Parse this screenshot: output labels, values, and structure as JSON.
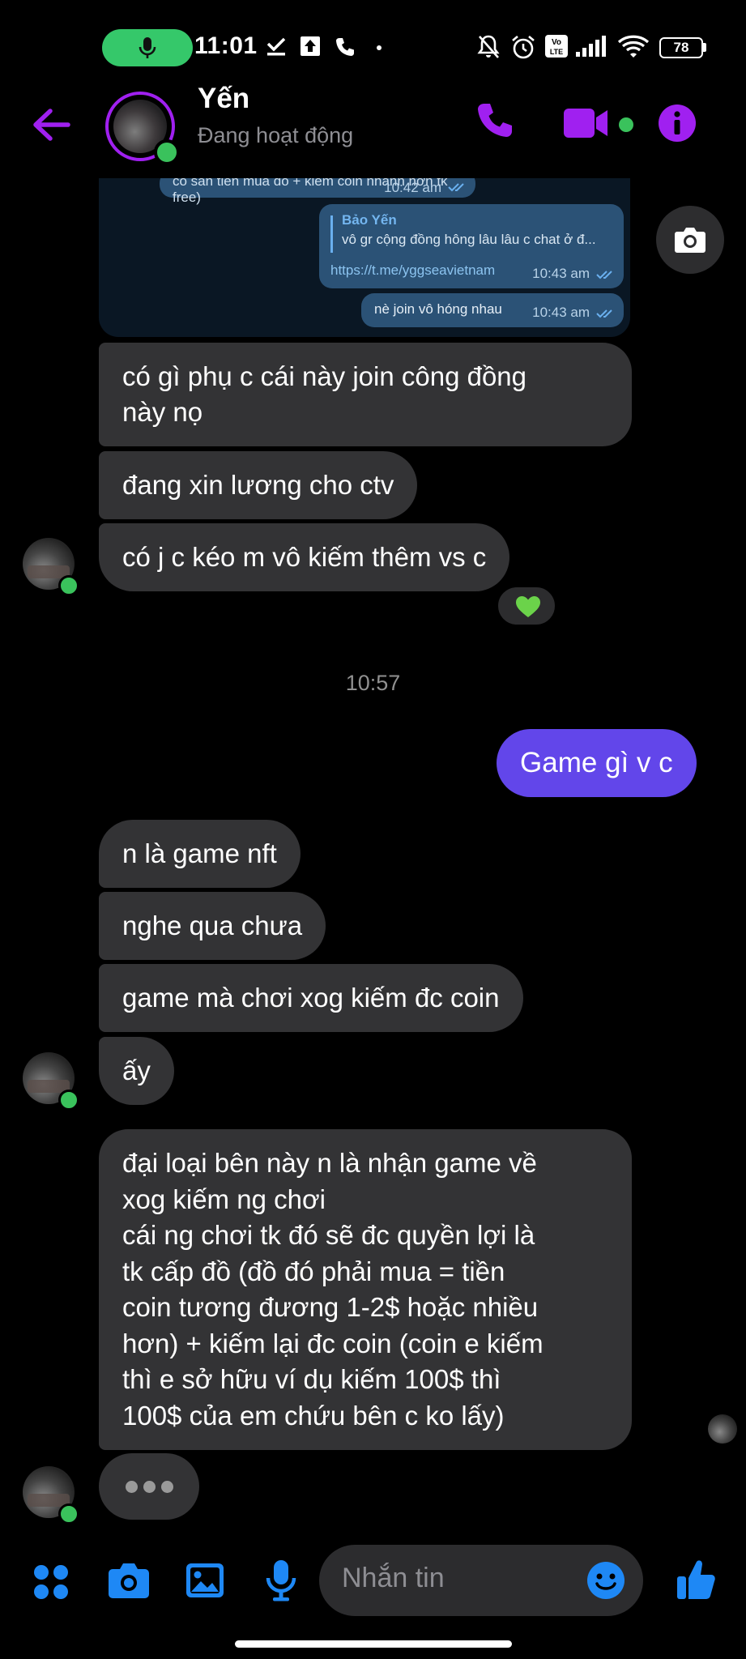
{
  "status_bar": {
    "time": "11:01",
    "battery": "78"
  },
  "header": {
    "contact_name": "Yến",
    "contact_status": "Đang hoạt động"
  },
  "shared_image": {
    "bubble1_text": "có sẵn tiền mua đồ + kiếm coin nhanh hơn tk free)",
    "bubble1_time": "10:42 am",
    "reply_name": "Bảo Yến",
    "reply_quote": "vô gr cộng đồng hông lâu lâu c chat ở đ...",
    "link": "https://t.me/yggseavietnam",
    "bubble2_time": "10:43 am",
    "bubble3_text": "nè join vô hóng nhau",
    "bubble3_time": "10:43 am"
  },
  "messages": {
    "m1": "có gì phụ c cái này join công đồng\nnày nọ",
    "m2": "đang xin lương cho ctv",
    "m3": "có j c kéo m vô kiếm thêm vs c",
    "timestamp": "10:57",
    "out1": "Game gì v c",
    "m4": "n là game nft",
    "m5": "nghe qua chưa",
    "m6": "game mà chơi xog kiếm đc coin",
    "m7": "ấy",
    "m8": "đại loại bên này n là nhận game về\nxog kiếm ng chơi\ncái ng chơi tk đó sẽ đc quyền lợi là\ntk cấp đồ (đồ đó phải mua = tiền\ncoin tương đương 1-2$ hoặc nhiều\nhơn) + kiếm lại đc coin (coin e kiếm\nthì e sở hữu ví dụ kiếm 100$ thì\n100$ của em chứu bên c ko lấy)"
  },
  "reaction": {
    "icon": "green-heart-icon",
    "color": "#6bd34a"
  },
  "composer": {
    "placeholder": "Nhắn tin"
  },
  "colors": {
    "accent": "#a020f0",
    "outgoing_bubble": "#6246ea",
    "incoming_bubble": "#333335",
    "online": "#3ac25c",
    "action_icons": "#1e88f5"
  }
}
